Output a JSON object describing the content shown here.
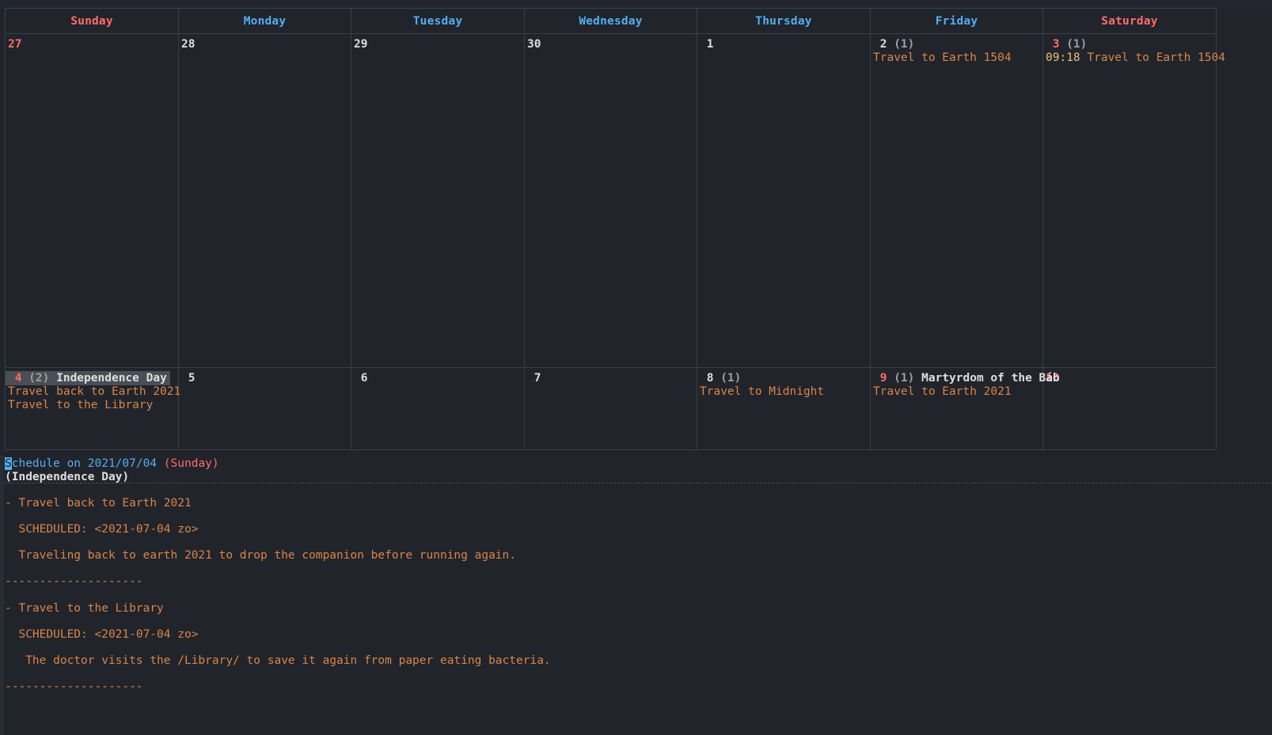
{
  "app": {
    "view": "calendar-month",
    "theme_background": "#21242b",
    "accent_blue": "#51afef",
    "accent_red": "#ff6c6b",
    "accent_orange": "#da8548",
    "accent_yellow": "#ecbe7b",
    "text_default": "#dfdfdf",
    "grid_line": "#3b3f4a",
    "selection_bg": "#4a4e57"
  },
  "calendar": {
    "day_headers": [
      {
        "label": "Sunday",
        "kind": "weekend"
      },
      {
        "label": "Monday",
        "kind": "weekday"
      },
      {
        "label": "Tuesday",
        "kind": "weekday"
      },
      {
        "label": "Wednesday",
        "kind": "weekday"
      },
      {
        "label": "Thursday",
        "kind": "weekday"
      },
      {
        "label": "Friday",
        "kind": "weekday"
      },
      {
        "label": "Saturday",
        "kind": "weekend"
      }
    ],
    "weeks": [
      {
        "days": [
          {
            "num": "27",
            "weekend": true,
            "count": "",
            "holiday": "",
            "selected": false,
            "events": []
          },
          {
            "num": "28",
            "weekend": false,
            "count": "",
            "holiday": "",
            "selected": false,
            "events": []
          },
          {
            "num": "29",
            "weekend": false,
            "count": "",
            "holiday": "",
            "selected": false,
            "events": []
          },
          {
            "num": "30",
            "weekend": false,
            "count": "",
            "holiday": "",
            "selected": false,
            "events": []
          },
          {
            "num": "1",
            "weekend": false,
            "count": "",
            "holiday": "",
            "selected": false,
            "events": []
          },
          {
            "num": "2",
            "weekend": false,
            "count": "(1)",
            "holiday": "",
            "selected": false,
            "events": [
              {
                "time": "",
                "text": "Travel to Earth 1504"
              }
            ]
          },
          {
            "num": "3",
            "weekend": true,
            "count": "(1)",
            "holiday": "",
            "selected": false,
            "events": [
              {
                "time": "09:18 ",
                "text": "Travel to Earth 1504"
              }
            ]
          }
        ]
      },
      {
        "days": [
          {
            "num": "4",
            "weekend": true,
            "count": "(2)",
            "holiday": "Independence Day",
            "selected": true,
            "events": [
              {
                "time": "",
                "text": "Travel back to Earth 2021"
              },
              {
                "time": "",
                "text": "Travel to the Library"
              }
            ]
          },
          {
            "num": "5",
            "weekend": false,
            "count": "",
            "holiday": "",
            "selected": false,
            "events": []
          },
          {
            "num": "6",
            "weekend": false,
            "count": "",
            "holiday": "",
            "selected": false,
            "events": []
          },
          {
            "num": "7",
            "weekend": false,
            "count": "",
            "holiday": "",
            "selected": false,
            "events": []
          },
          {
            "num": "8",
            "weekend": false,
            "count": "(1)",
            "holiday": "",
            "selected": false,
            "events": [
              {
                "time": "",
                "text": "Travel to Midnight"
              }
            ]
          },
          {
            "num": "9",
            "weekend": false,
            "count": "(1)",
            "holiday": "Martyrdom of the Báb",
            "selected": false,
            "num_is_red": true,
            "events": [
              {
                "time": "",
                "text": "Travel to Earth 2021"
              }
            ]
          },
          {
            "num": "10",
            "weekend": true,
            "count": "",
            "holiday": "",
            "selected": false,
            "events": []
          }
        ]
      }
    ]
  },
  "schedule": {
    "header_cursor_char": "S",
    "header_rest": "chedule on 2021/07/04 ",
    "header_weekday": "(Sunday)",
    "header_holiday": "(Independence Day)",
    "separator": "--------------------",
    "entries": [
      {
        "title": "- Travel back to Earth 2021",
        "scheduled": "  SCHEDULED: <2021-07-04 zo>",
        "body": "  Traveling back to earth 2021 to drop the companion before running again."
      },
      {
        "title": "- Travel to the Library",
        "scheduled": "  SCHEDULED: <2021-07-04 zo>",
        "body": "   The doctor visits the /Library/ to save it again from paper eating bacteria."
      }
    ]
  }
}
